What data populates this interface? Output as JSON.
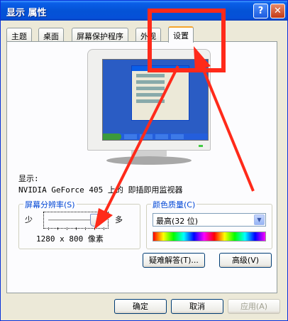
{
  "window": {
    "title": "显示 属性",
    "help_glyph": "?",
    "close_glyph": "✕"
  },
  "tabs": [
    {
      "label": "主题"
    },
    {
      "label": "桌面"
    },
    {
      "label": "屏幕保护程序"
    },
    {
      "label": "外观"
    },
    {
      "label": "设置",
      "active": true
    }
  ],
  "display": {
    "label": "显示:",
    "value": "NVIDIA GeForce 405 上的 即插即用监视器"
  },
  "resolution": {
    "title": "屏幕分辨率(S)",
    "less_label": "少",
    "more_label": "多",
    "value_text": "1280 x 800 像素",
    "slider_fraction": 0.82
  },
  "color_quality": {
    "title": "颜色质量(C)",
    "selected": "最高(32 位)"
  },
  "buttons": {
    "troubleshoot": "疑难解答(T)...",
    "advanced": "高级(V)",
    "ok": "确定",
    "cancel": "取消",
    "apply": "应用(A)"
  },
  "icons": {
    "help": "help-icon",
    "close": "close-icon",
    "dropdown": "chevron-down-icon"
  },
  "colors": {
    "titlebar": "#0453d6",
    "dialog_bg": "#ece9d8",
    "group_title": "#0046d5",
    "annotation": "#ff2a1a"
  }
}
